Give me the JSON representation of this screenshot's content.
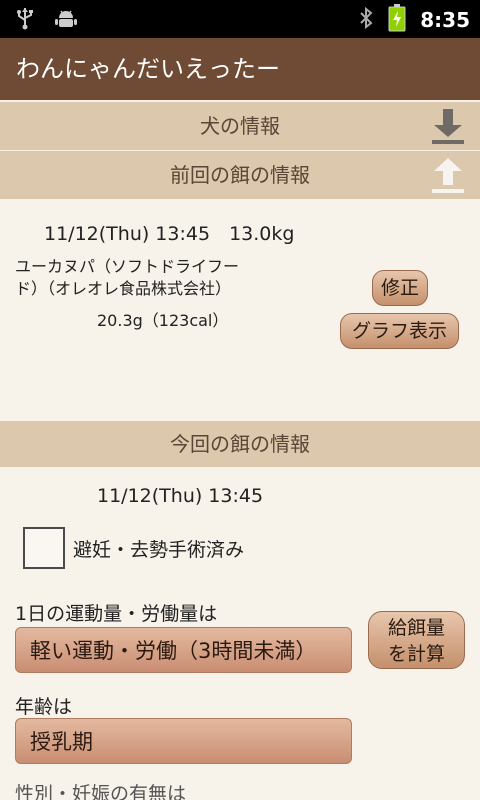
{
  "status_bar": {
    "left_icons": [
      "usb-icon",
      "android-debug-icon"
    ],
    "right_icons": [
      "bluetooth-icon",
      "battery-charging-icon"
    ],
    "time": "8:35",
    "colors": {
      "battery": "#8fd000"
    }
  },
  "app": {
    "title": "わんにゃんだいえったー"
  },
  "dog_info_header": {
    "label": "犬の情報",
    "icon": "download-icon"
  },
  "previous_meal_header": {
    "label": "前回の餌の情報",
    "icon": "upload-icon"
  },
  "previous_meal": {
    "datetime_weight": "11/12(Thu) 13:45　13.0kg",
    "food_name_line1": "ユーカヌパ（ソフトドライフー",
    "food_name_line2": "ド）（オレオレ食品株式会社）",
    "amount": "20.3g（123cal）",
    "edit_button": "修正",
    "graph_button": "グラフ表示"
  },
  "current_meal_header": {
    "label": "今回の餌の情報"
  },
  "current_meal": {
    "datetime": "11/12(Thu) 13:45",
    "neuter_label": "避妊・去勢手術済み",
    "exercise_label": "1日の運動量・労働量は",
    "exercise_value": "軽い運動・労働（3時間未満）",
    "calc_button_line1": "給餌量",
    "calc_button_line2": "を計算",
    "age_label": "年齢は",
    "age_value": "授乳期",
    "gender_label": "性別・妊娠の有無は"
  },
  "colors": {
    "title_bar": "#6f4a34",
    "section_header": "#dcc8ac",
    "button": "#c4906c",
    "background": "#f5f0e8"
  }
}
